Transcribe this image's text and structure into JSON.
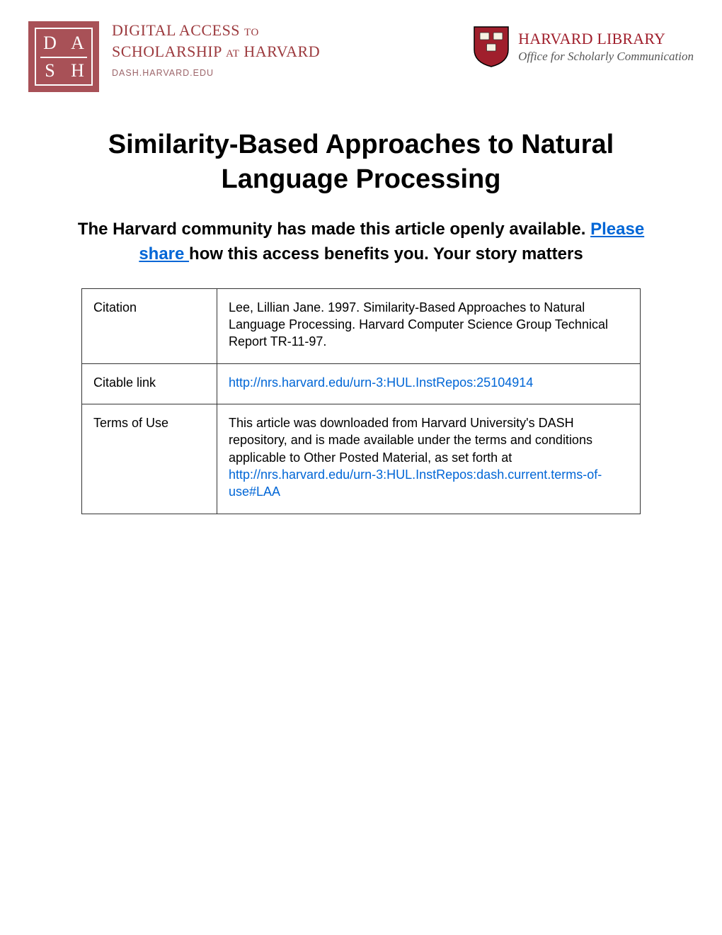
{
  "dash": {
    "logo_letters": [
      "D",
      "A",
      "S",
      "H"
    ],
    "line1_a": "DIGITAL ACCESS",
    "line1_b": "TO",
    "line2_a": "SCHOLARSHIP",
    "line2_b": "AT",
    "line2_c": "HARVARD",
    "url": "DASH.HARVARD.EDU"
  },
  "harvard": {
    "line1": "HARVARD LIBRARY",
    "line2": "Office for Scholarly Communication"
  },
  "title": "Similarity-Based Approaches to Natural Language Processing",
  "subtitle": {
    "part1": "The Harvard community has made this article openly available. ",
    "link": " Please share ",
    "part2": " how this access benefits you. Your story matters"
  },
  "table": {
    "citation": {
      "label": "Citation",
      "value": "Lee, Lillian Jane. 1997. Similarity-Based Approaches to Natural Language Processing. Harvard Computer Science Group Technical Report TR-11-97."
    },
    "citable_link": {
      "label": "Citable link",
      "url": "http://nrs.harvard.edu/urn-3:HUL.InstRepos:25104914"
    },
    "terms": {
      "label": "Terms of Use",
      "text": "This article was downloaded from Harvard University's DASH repository, and is made available under the terms and conditions applicable to Other Posted Material, as set forth at ",
      "url_text": "http://nrs.harvard.edu/urn-3:HUL.InstRepos:dash.current.terms-of-use#LAA"
    }
  }
}
